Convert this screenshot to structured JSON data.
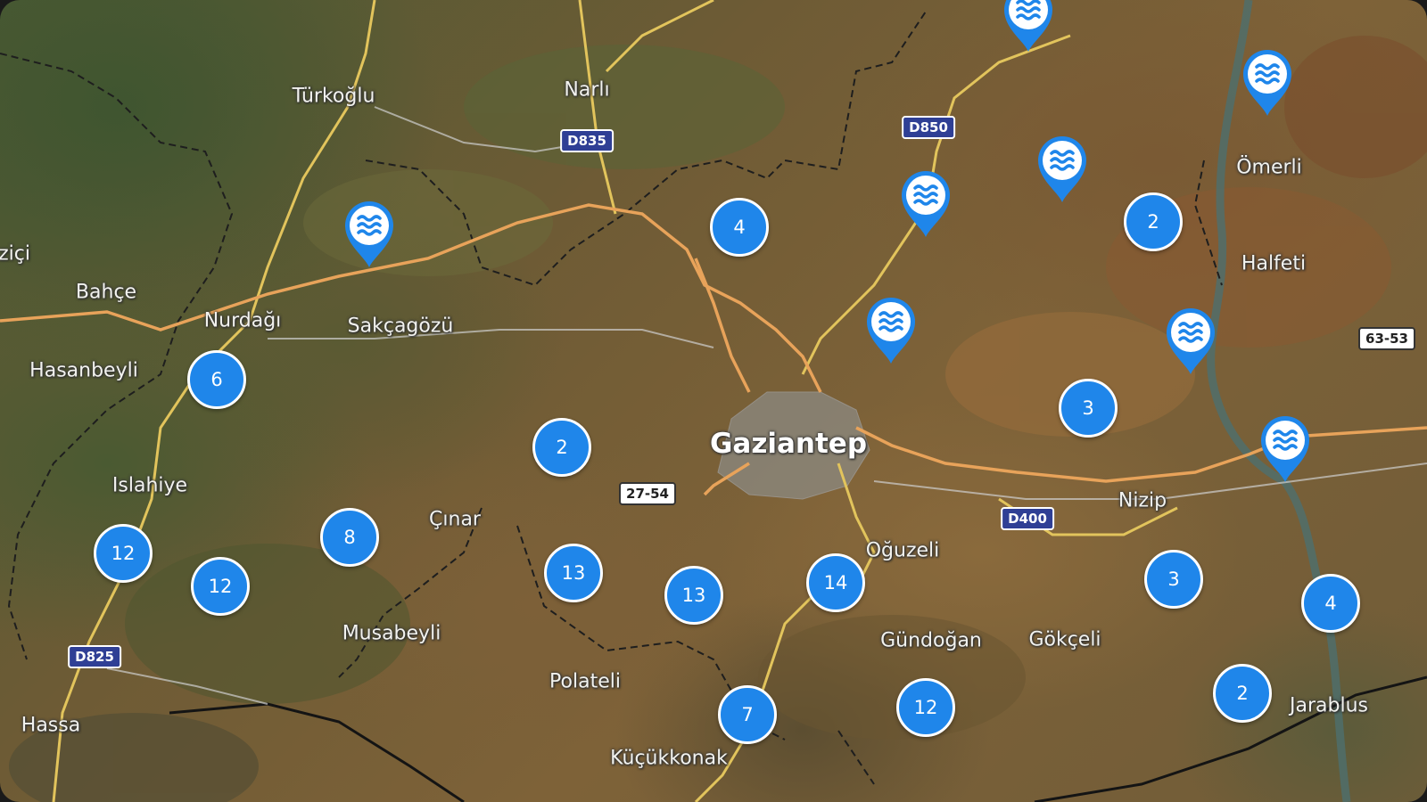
{
  "map": {
    "colors": {
      "cluster_fill": "#1f86ea",
      "marker_fill": "#1f86ea",
      "road_major": "#e8a35a",
      "road_yellow": "#e2c45c",
      "road_minor": "#cfcfcf",
      "border": "#222222",
      "shield_blue": "#2f3f95"
    },
    "place_labels": [
      {
        "name": "Türkoğlu"
      },
      {
        "name": "Narlı"
      },
      {
        "name": "Ömerli"
      },
      {
        "name": "Halfeti"
      },
      {
        "name": "ziçi"
      },
      {
        "name": "Bahçe"
      },
      {
        "name": "Nurdağı"
      },
      {
        "name": "Sakçagözü"
      },
      {
        "name": "Hasanbeyli"
      },
      {
        "name": "Islahiye"
      },
      {
        "name": "Gaziantep",
        "prominent": true
      },
      {
        "name": "Çınar"
      },
      {
        "name": "Musabeyli"
      },
      {
        "name": "Polateli"
      },
      {
        "name": "Oğuzeli"
      },
      {
        "name": "Nizip"
      },
      {
        "name": "Gündoğan"
      },
      {
        "name": "Gökçeli"
      },
      {
        "name": "Jarablus"
      },
      {
        "name": "Hassa"
      },
      {
        "name": "Küçükkonak"
      }
    ],
    "road_shields": [
      {
        "label": "D835",
        "style": "blue"
      },
      {
        "label": "D850",
        "style": "blue"
      },
      {
        "label": "D400",
        "style": "blue"
      },
      {
        "label": "D825",
        "style": "blue"
      },
      {
        "label": "27-54",
        "style": "white"
      },
      {
        "label": "63-53",
        "style": "white"
      }
    ],
    "clusters": [
      {
        "count": "4"
      },
      {
        "count": "2"
      },
      {
        "count": "6"
      },
      {
        "count": "2"
      },
      {
        "count": "3"
      },
      {
        "count": "8"
      },
      {
        "count": "12"
      },
      {
        "count": "12"
      },
      {
        "count": "13"
      },
      {
        "count": "13"
      },
      {
        "count": "14"
      },
      {
        "count": "3"
      },
      {
        "count": "4"
      },
      {
        "count": "7"
      },
      {
        "count": "12"
      },
      {
        "count": "2"
      }
    ],
    "markers": [
      {
        "icon": "water-waves-icon"
      },
      {
        "icon": "water-waves-icon"
      },
      {
        "icon": "water-waves-icon"
      },
      {
        "icon": "water-waves-icon"
      },
      {
        "icon": "water-waves-icon"
      },
      {
        "icon": "water-waves-icon"
      },
      {
        "icon": "water-waves-icon"
      },
      {
        "icon": "water-waves-icon"
      }
    ]
  }
}
